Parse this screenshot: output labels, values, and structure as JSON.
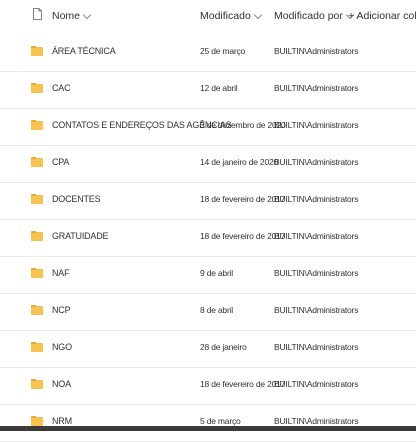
{
  "header": {
    "name_label": "Nome",
    "modified_label": "Modificado",
    "modified_by_label": "Modificado por",
    "add_column_label": "+ Adicionar coluna"
  },
  "rows": [
    {
      "name": "ÁREA TÉCNICA",
      "modified": "25 de março",
      "modified_by": "BUILTIN\\Administrators"
    },
    {
      "name": "CAC",
      "modified": "12 de abril",
      "modified_by": "BUILTIN\\Administrators"
    },
    {
      "name": "CONTATOS E ENDEREÇOS DAS AGÊNCIAS",
      "modified": "3 de dezembro de 2020",
      "modified_by": "BUILTIN\\Administrators"
    },
    {
      "name": "CPA",
      "modified": "14 de janeiro de 2020",
      "modified_by": "BUILTIN\\Administrators"
    },
    {
      "name": "DOCENTES",
      "modified": "18 de fevereiro de 2017",
      "modified_by": "BUILTIN\\Administrators"
    },
    {
      "name": "GRATUIDADE",
      "modified": "18 de fevereiro de 2017",
      "modified_by": "BUILTIN\\Administrators"
    },
    {
      "name": "NAF",
      "modified": "9 de abril",
      "modified_by": "BUILTIN\\Administrators"
    },
    {
      "name": "NCP",
      "modified": "8 de abril",
      "modified_by": "BUILTIN\\Administrators"
    },
    {
      "name": "NGO",
      "modified": "28 de janeiro",
      "modified_by": "BUILTIN\\Administrators"
    },
    {
      "name": "NOA",
      "modified": "18 de fevereiro de 2017",
      "modified_by": "BUILTIN\\Administrators"
    },
    {
      "name": "NRM",
      "modified": "5 de março",
      "modified_by": "BUILTIN\\Administrators"
    }
  ],
  "colors": {
    "folder": "#f8c44f",
    "folder_tab": "#e9a92c",
    "divider": "#edebe9"
  },
  "icons": {
    "file_type": "file-type-icon",
    "folder": "folder-icon",
    "chevron": "chevron-down-icon"
  }
}
